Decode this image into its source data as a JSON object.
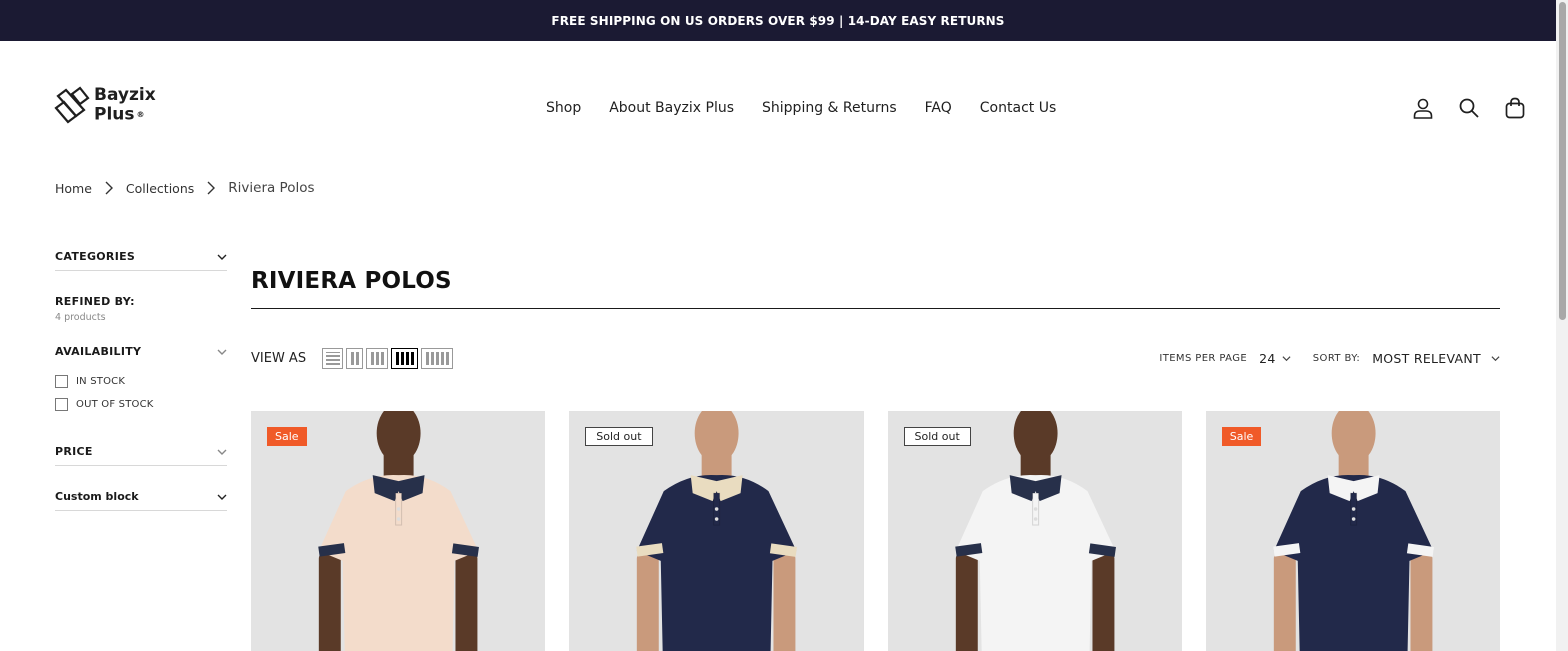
{
  "announcement": "FREE SHIPPING ON US ORDERS OVER $99 | 14-DAY EASY RETURNS",
  "brand": {
    "line1": "Bayzix",
    "line2": "Plus",
    "reg": "®"
  },
  "nav": [
    "Shop",
    "About Bayzix Plus",
    "Shipping & Returns",
    "FAQ",
    "Contact Us"
  ],
  "header_icons": [
    "account-icon",
    "search-icon",
    "cart-icon"
  ],
  "breadcrumb": [
    "Home",
    "Collections",
    "Riviera Polos"
  ],
  "sidebar": {
    "categories": "CATEGORIES",
    "refined_by": "REFINED BY:",
    "product_count": "4 products",
    "availability": "AVAILABILITY",
    "options": [
      "IN STOCK",
      "OUT OF STOCK"
    ],
    "price": "PRICE",
    "custom_block": "Custom block"
  },
  "collection_title": "RIVIERA POLOS",
  "toolbar": {
    "view_as": "VIEW AS",
    "view_modes": [
      "list",
      "2-column",
      "3-column",
      "4-column",
      "5-column"
    ],
    "active_view": "4-column",
    "items_per_page_label": "ITEMS PER PAGE",
    "items_per_page_value": "24",
    "sort_label": "SORT BY:",
    "sort_value": "MOST RELEVANT"
  },
  "products": [
    {
      "badge": "Sale",
      "badge_type": "sale",
      "shirt_color": "#f3dccb",
      "collar_color": "#27304a",
      "skin": "#5a3a28"
    },
    {
      "badge": "Sold out",
      "badge_type": "sold",
      "shirt_color": "#22294a",
      "collar_color": "#e9dcc0",
      "skin": "#c99a7c"
    },
    {
      "badge": "Sold out",
      "badge_type": "sold",
      "shirt_color": "#f4f4f4",
      "collar_color": "#27304a",
      "skin": "#5a3a28"
    },
    {
      "badge": "Sale",
      "badge_type": "sale",
      "shirt_color": "#22294a",
      "collar_color": "#f4f4f4",
      "skin": "#c99a7c"
    }
  ],
  "colors": {
    "announcement_bg": "#1b1a33",
    "sale": "#f05a28"
  }
}
